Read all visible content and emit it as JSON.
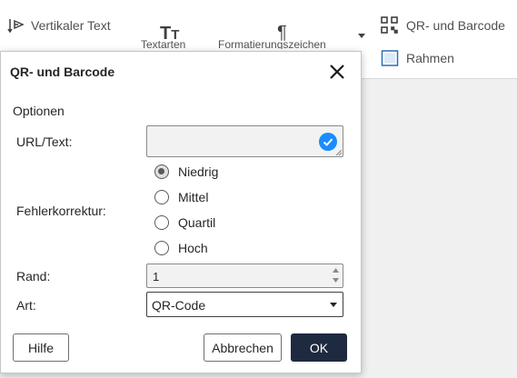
{
  "toolbar": {
    "vertical_text": "Vertikaler Text",
    "text_style_cut": "Textarten",
    "format_cut": "Formatierungszeichen",
    "qr_barcode": "QR- und Barcode",
    "frame": "Rahmen"
  },
  "dialog": {
    "title": "QR- und Barcode",
    "section_options": "Optionen",
    "url_label": "URL/Text:",
    "url_value": "",
    "error_correction_label": "Fehlerkorrektur:",
    "error_correction_options": [
      {
        "label": "Niedrig",
        "checked": true
      },
      {
        "label": "Mittel",
        "checked": false
      },
      {
        "label": "Quartil",
        "checked": false
      },
      {
        "label": "Hoch",
        "checked": false
      }
    ],
    "margin_label": "Rand:",
    "margin_value": "1",
    "type_label": "Art:",
    "type_value": "QR-Code",
    "help_button": "Hilfe",
    "cancel_button": "Abbrechen",
    "ok_button": "OK"
  },
  "colors": {
    "primary_button": "#1e2a3f",
    "check_badge": "#1a8cff"
  }
}
